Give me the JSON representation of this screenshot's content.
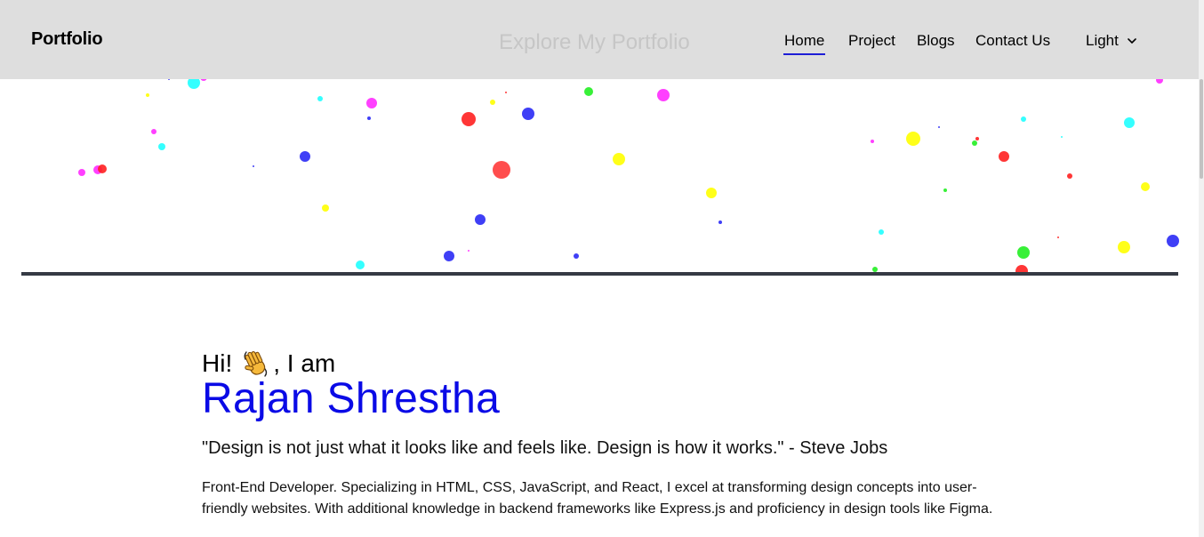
{
  "nav": {
    "brand": "Portfolio",
    "center_title": "Explore My Portfolio",
    "links": [
      {
        "label": "Home",
        "active": true
      },
      {
        "label": "Project",
        "active": false
      },
      {
        "label": "Blogs",
        "active": false
      },
      {
        "label": "Contact Us",
        "active": false
      }
    ],
    "theme": {
      "selected": "Light",
      "icon": "chevron-down-icon"
    }
  },
  "hero": {
    "greeting_prefix": "Hi!",
    "greeting_icon": "waving-hand-icon",
    "greeting_suffix": ", I am",
    "name": "Rajan Shrestha",
    "quote": "\"Design is not just what it looks like and feels like. Design is how it works.\" - Steve Jobs",
    "bio": "Front-End Developer. Specializing in HTML, CSS, JavaScript, and React, I excel at transforming design concepts into user-friendly websites. With additional knowledge in backend frameworks like Express.js and proficiency in design tools like Figma."
  },
  "colors": {
    "navbar_bg": "#dedede",
    "active_underline": "#1d1dd6",
    "name": "#0a0ae6",
    "divider": "#353a44",
    "particle_palette": [
      "#ffff00",
      "#ff2bff",
      "#1fffff",
      "#ff2020",
      "#2a2af5",
      "#22ee22"
    ]
  }
}
